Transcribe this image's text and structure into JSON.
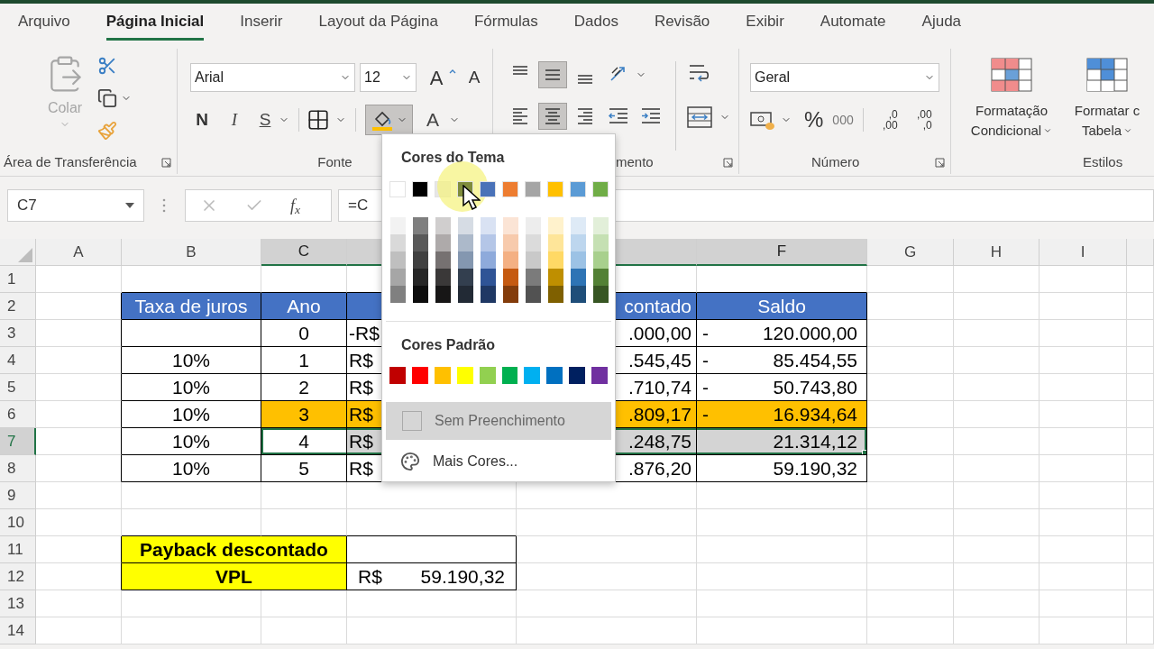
{
  "tabs": [
    {
      "label": "Arquivo",
      "selected": false
    },
    {
      "label": "Página Inicial",
      "selected": true
    },
    {
      "label": "Inserir",
      "selected": false
    },
    {
      "label": "Layout da Página",
      "selected": false
    },
    {
      "label": "Fórmulas",
      "selected": false
    },
    {
      "label": "Dados",
      "selected": false
    },
    {
      "label": "Revisão",
      "selected": false
    },
    {
      "label": "Exibir",
      "selected": false
    },
    {
      "label": "Automate",
      "selected": false
    },
    {
      "label": "Ajuda",
      "selected": false
    }
  ],
  "ribbon": {
    "clipboard": {
      "paste": "Colar",
      "paste_disabled": true,
      "label": "Área de Transferência"
    },
    "font": {
      "name": "Arial",
      "size": "12",
      "grow": "A",
      "shrink": "A",
      "bold": "N",
      "italic": "I",
      "underline": "S",
      "font_color": "A",
      "fill_open": true,
      "label": "Fonte"
    },
    "alignment": {
      "vertical": [
        {
          "kind": "top",
          "selected": false
        },
        {
          "kind": "middle",
          "selected": true
        },
        {
          "kind": "bottom",
          "selected": false
        }
      ],
      "horizontal": [
        {
          "kind": "left",
          "selected": false
        },
        {
          "kind": "center",
          "selected": true
        },
        {
          "kind": "right",
          "selected": false
        }
      ],
      "label": "mento"
    },
    "number": {
      "format": "Geral",
      "percent": "%",
      "thousands": "000",
      "decimals": [
        {
          "top": ",0",
          "bottom": ",00"
        },
        {
          "top": ",00",
          "bottom": ",0"
        }
      ],
      "label": "Número"
    },
    "styles": {
      "buttons": [
        {
          "lines": [
            "Formatação",
            "Condicional"
          ]
        },
        {
          "lines": [
            "Formatar c",
            "Tabela"
          ]
        }
      ],
      "label": "Estilos"
    }
  },
  "formula_bar": {
    "name_box": "C7",
    "function_label": "f$_{x}$",
    "formula": "=C"
  },
  "sheet": {
    "columns": [
      {
        "label": "A",
        "selected": false
      },
      {
        "label": "B",
        "selected": false
      },
      {
        "label": "C",
        "selected": true
      },
      {
        "selected": true
      },
      {
        "selected": true
      },
      {
        "label": "F",
        "selected": true
      },
      {
        "label": "G",
        "selected": false
      },
      {
        "label": "H",
        "selected": false
      },
      {
        "label": "I",
        "selected": false
      },
      {
        "selected": false
      }
    ],
    "rows": [
      {
        "number": "1",
        "selected": false
      },
      {
        "number": "2",
        "selected": false
      },
      {
        "number": "3",
        "selected": false
      },
      {
        "number": "4",
        "selected": false
      },
      {
        "number": "5",
        "selected": false
      },
      {
        "number": "6",
        "selected": false
      },
      {
        "number": "7",
        "selected": true
      },
      {
        "number": "8",
        "selected": false
      },
      {
        "number": "9",
        "selected": false
      },
      {
        "number": "10",
        "selected": false
      },
      {
        "number": "11",
        "selected": false
      },
      {
        "number": "12",
        "selected": false
      },
      {
        "number": "13",
        "selected": false
      },
      {
        "number": "14",
        "selected": false
      }
    ]
  },
  "table": {
    "header": {
      "rate": "Taxa de juros",
      "year": "Ano",
      "column_e": "contado",
      "balance": "Saldo"
    },
    "rows": [
      {
        "year": "0",
        "column_d": "-R$",
        "column_e": ".000,00",
        "sign": "-",
        "balance": "120.000,00",
        "highlighted": false,
        "selected": false
      },
      {
        "rate": "10%",
        "year": "1",
        "column_d": "R$",
        "column_e": ".545,45",
        "sign": "-",
        "balance": "85.454,55",
        "highlighted": false,
        "selected": false
      },
      {
        "rate": "10%",
        "year": "2",
        "column_d": "R$",
        "column_e": ".710,74",
        "sign": "-",
        "balance": "50.743,80",
        "highlighted": false,
        "selected": false
      },
      {
        "rate": "10%",
        "year": "3",
        "column_d": "R$",
        "column_e": ".809,17",
        "sign": "-",
        "balance": "16.934,64",
        "highlighted": true,
        "selected": false
      },
      {
        "rate": "10%",
        "year": "4",
        "column_d": "R$",
        "column_e": ".248,75",
        "balance": "21.314,12",
        "highlighted": false,
        "selected": true
      },
      {
        "rate": "10%",
        "year": "5",
        "column_d": "R$",
        "column_e": ".876,20",
        "balance": "59.190,32",
        "highlighted": false,
        "selected": false
      }
    ]
  },
  "summary": {
    "payback_label": "Payback descontado",
    "vpl_label": "VPL",
    "vpl_currency": "R$",
    "vpl_value": "59.190,32"
  },
  "color_menu": {
    "theme_title": "Cores do Tema",
    "theme_colors": [
      {
        "color": "#ffffff",
        "hovered": false,
        "shades": [
          {
            "color": "#f2f2f2"
          },
          {
            "color": "#d9d9d9"
          },
          {
            "color": "#bfbfbf"
          },
          {
            "color": "#a6a6a6"
          },
          {
            "color": "#808080"
          }
        ]
      },
      {
        "color": "#000000",
        "hovered": false,
        "shades": [
          {
            "color": "#7f7f7f"
          },
          {
            "color": "#595959"
          },
          {
            "color": "#404040"
          },
          {
            "color": "#262626"
          },
          {
            "color": "#0d0d0d"
          }
        ]
      },
      {
        "color": "#e7e6e6",
        "hovered": false,
        "shades": [
          {
            "color": "#d0cece"
          },
          {
            "color": "#aeaaaa"
          },
          {
            "color": "#767171"
          },
          {
            "color": "#3a3838"
          },
          {
            "color": "#171616"
          }
        ]
      },
      {
        "color": "#7f8c3c",
        "hovered": true,
        "shades": [
          {
            "color": "#d6dce4"
          },
          {
            "color": "#acb9ca"
          },
          {
            "color": "#8497b0"
          },
          {
            "color": "#333f4f"
          },
          {
            "color": "#222a35"
          }
        ]
      },
      {
        "color": "#4a72b8",
        "hovered": false,
        "shades": [
          {
            "color": "#d9e2f3"
          },
          {
            "color": "#b4c6e7"
          },
          {
            "color": "#8eaadb"
          },
          {
            "color": "#2f5496"
          },
          {
            "color": "#1f3864"
          }
        ]
      },
      {
        "color": "#ed7d31",
        "hovered": false,
        "shades": [
          {
            "color": "#fbe4d5"
          },
          {
            "color": "#f7caac"
          },
          {
            "color": "#f4b083"
          },
          {
            "color": "#c55a11"
          },
          {
            "color": "#833c0b"
          }
        ]
      },
      {
        "color": "#a5a5a5",
        "hovered": false,
        "shades": [
          {
            "color": "#ededed"
          },
          {
            "color": "#dbdbdb"
          },
          {
            "color": "#c9c9c9"
          },
          {
            "color": "#7b7b7b"
          },
          {
            "color": "#525252"
          }
        ]
      },
      {
        "color": "#ffc000",
        "hovered": false,
        "shades": [
          {
            "color": "#fff2cc"
          },
          {
            "color": "#fee599"
          },
          {
            "color": "#ffd965"
          },
          {
            "color": "#bf8f00"
          },
          {
            "color": "#7f6000"
          }
        ]
      },
      {
        "color": "#5b9bd5",
        "hovered": false,
        "shades": [
          {
            "color": "#deeaf6"
          },
          {
            "color": "#bdd6ee"
          },
          {
            "color": "#9cc2e5"
          },
          {
            "color": "#2e74b5"
          },
          {
            "color": "#1f4e79"
          }
        ]
      },
      {
        "color": "#70ad47",
        "hovered": false,
        "shades": [
          {
            "color": "#e2efd9"
          },
          {
            "color": "#c5e0b3"
          },
          {
            "color": "#a8d08d"
          },
          {
            "color": "#538135"
          },
          {
            "color": "#375623"
          }
        ]
      }
    ],
    "standard_title": "Cores Padrão",
    "standard_colors": [
      {
        "color": "#c00000"
      },
      {
        "color": "#ff0000"
      },
      {
        "color": "#ffc000"
      },
      {
        "color": "#ffff00"
      },
      {
        "color": "#92d050"
      },
      {
        "color": "#00b050"
      },
      {
        "color": "#00b0f0"
      },
      {
        "color": "#0070c0"
      },
      {
        "color": "#002060"
      },
      {
        "color": "#7030a0"
      }
    ],
    "no_fill": {
      "label": "Sem Preenchimento",
      "highlighted": true
    },
    "more": {
      "label": "Mais Cores..."
    }
  }
}
